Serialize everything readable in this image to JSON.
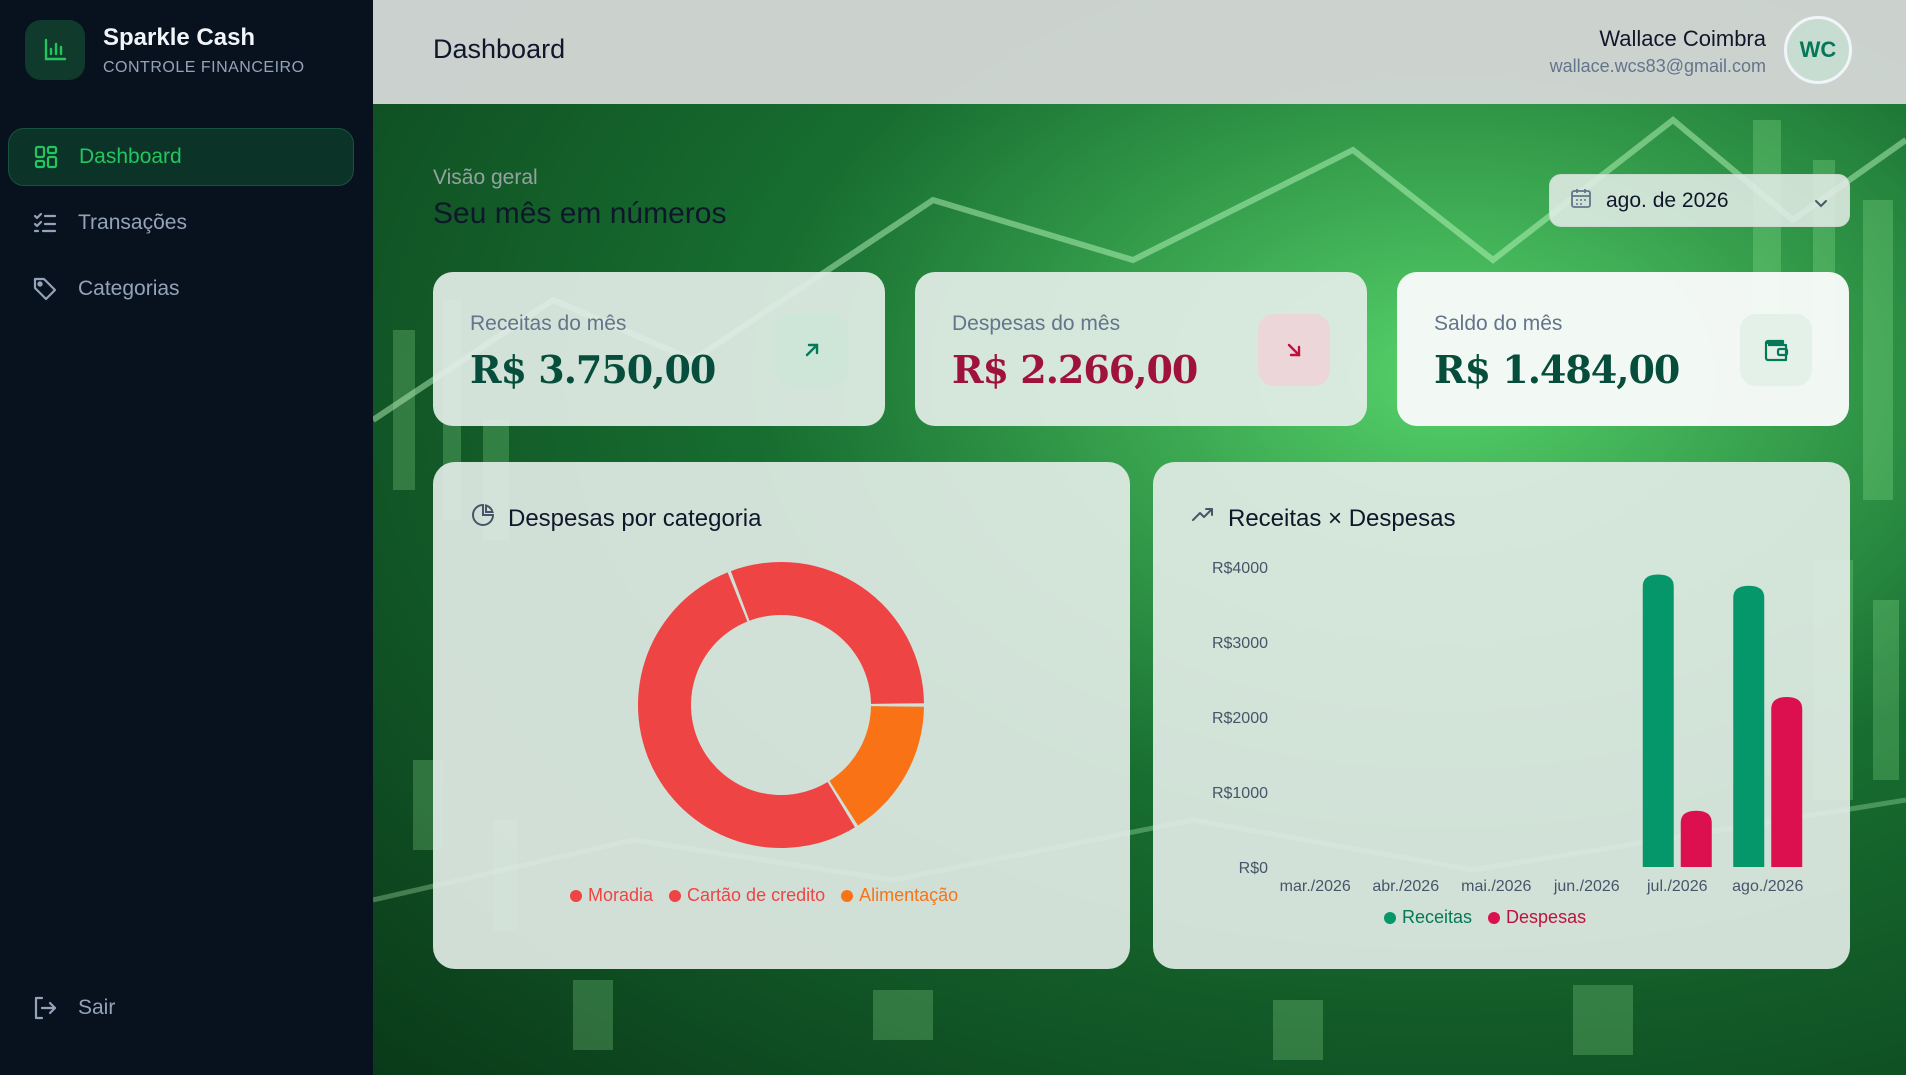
{
  "brand": {
    "name": "Sparkle Cash",
    "subtitle": "CONTROLE FINANCEIRO"
  },
  "nav": {
    "items": [
      {
        "label": "Dashboard",
        "icon": "dashboard-grid-icon",
        "active": true
      },
      {
        "label": "Transações",
        "icon": "checklist-icon",
        "active": false
      },
      {
        "label": "Categorias",
        "icon": "tag-icon",
        "active": false
      }
    ],
    "logout": "Sair"
  },
  "header": {
    "title": "Dashboard",
    "user_name": "Wallace Coimbra",
    "user_email": "wallace.wcs83@gmail.com",
    "avatar_initials": "WC"
  },
  "overview": {
    "label": "Visão geral",
    "title": "Seu mês em números",
    "month": "ago. de 2026"
  },
  "cards": [
    {
      "label": "Receitas do mês",
      "value": "R$ 3.750,00",
      "color": "#064e3b",
      "icon": "arrow-up-right-icon"
    },
    {
      "label": "Despesas do mês",
      "value": "R$ 2.266,00",
      "color": "#9f1239",
      "icon": "arrow-down-right-icon"
    },
    {
      "label": "Saldo do mês",
      "value": "R$ 1.484,00",
      "color": "#064e3b",
      "icon": "wallet-icon"
    }
  ],
  "panels": {
    "donut_title": "Despesas por categoria",
    "bar_title": "Receitas × Despesas"
  },
  "colors": {
    "accent": "#22c55e",
    "income": "#059669",
    "expense": "#dc0f4f",
    "moradia": "#ef4444",
    "cartao": "#ef4444",
    "alimentacao": "#f97316"
  },
  "chart_data": [
    {
      "type": "pie",
      "title": "Despesas por categoria",
      "categories": [
        "Moradia",
        "Cartão de credito",
        "Alimentação"
      ],
      "values": [
        1200,
        700,
        366
      ],
      "colors": [
        "#ef4444",
        "#ef4444",
        "#f97316"
      ],
      "legend": "bottom"
    },
    {
      "type": "bar",
      "title": "Receitas × Despesas",
      "categories": [
        "mar./2026",
        "abr./2026",
        "mai./2026",
        "jun./2026",
        "jul./2026",
        "ago./2026"
      ],
      "series": [
        {
          "name": "Receitas",
          "values": [
            0,
            0,
            0,
            0,
            3900,
            3750
          ],
          "color": "#059669"
        },
        {
          "name": "Despesas",
          "values": [
            0,
            0,
            0,
            0,
            750,
            2266
          ],
          "color": "#dc0f4f"
        }
      ],
      "y_ticks": [
        "R$0",
        "R$1000",
        "R$2000",
        "R$3000",
        "R$4000"
      ],
      "ylim": [
        0,
        4000
      ],
      "grid": false,
      "legend": "bottom"
    }
  ]
}
